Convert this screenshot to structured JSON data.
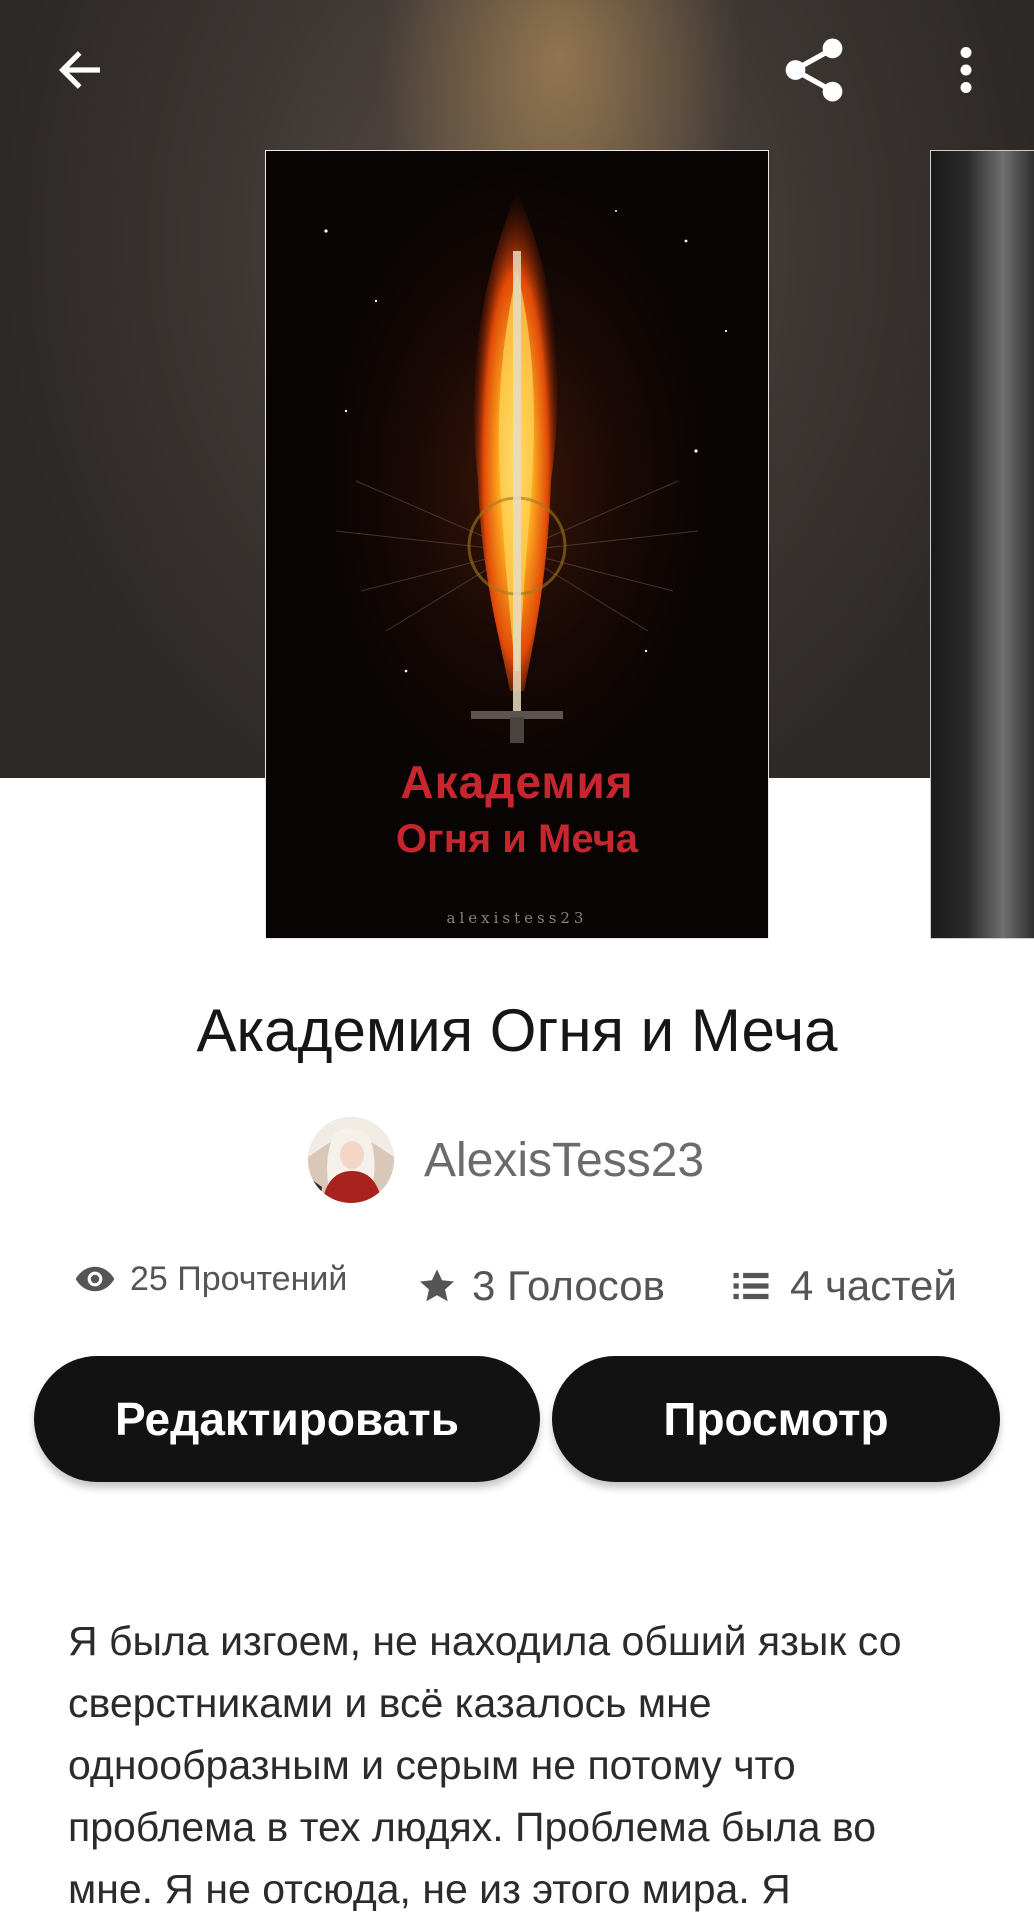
{
  "header": {
    "back_icon": "arrow-left-icon",
    "share_icon": "share-icon",
    "more_icon": "more-vertical-icon"
  },
  "cover": {
    "title_line1": "Академия",
    "title_line2": "Огня и Меча",
    "author_text": "alexistess23"
  },
  "story": {
    "title": "Академия Огня и Меча",
    "author": "AlexisTess23"
  },
  "stats": {
    "reads": "25 Прочтений",
    "votes": "3 Голосов",
    "parts": "4 частей"
  },
  "actions": {
    "edit_label": "Редактировать",
    "view_label": "Просмотр"
  },
  "description": "Я была изгоем, не находила обший язык со сверстниками и всё казалось мне однообразным и серым не потому что проблема в тех людях. Проблема была во мне. Я не отсюда, не из этого мира. Я",
  "colors": {
    "button_bg": "#121212",
    "cover_title": "#c7262e",
    "stat_text": "#555555"
  }
}
